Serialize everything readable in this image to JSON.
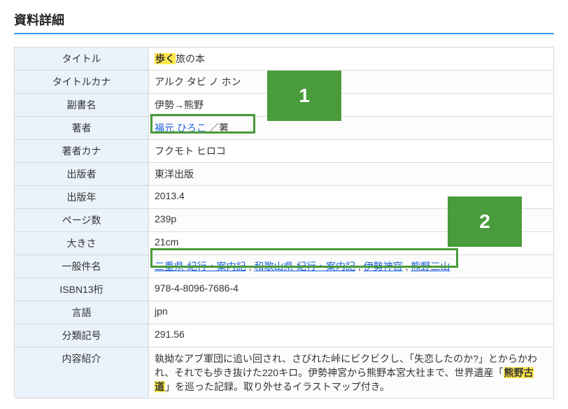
{
  "section_title": "資料詳細",
  "labels": {
    "title": "タイトル",
    "title_kana": "タイトルカナ",
    "subtitle": "副書名",
    "author": "著者",
    "author_kana": "著者カナ",
    "publisher": "出版者",
    "pub_year": "出版年",
    "pages": "ページ数",
    "size": "大きさ",
    "subjects": "一般件名",
    "isbn13": "ISBN13桁",
    "language": "言語",
    "class_no": "分類記号",
    "description": "内容紹介"
  },
  "values": {
    "title_highlight": "歩く",
    "title_rest": "旅の本",
    "title_kana": "アルク タビ ノ ホン",
    "subtitle": "伊勢→熊野",
    "author_link": "福元 ひろこ",
    "author_suffix": " ／著",
    "author_kana": "フクモト ヒロコ",
    "publisher": "東洋出版",
    "pub_year": "2013.4",
    "pages": "239p",
    "size": "21cm",
    "subject_sep": " , ",
    "subject1": "三重県-紀行・案内記",
    "subject2": "和歌山県-紀行・案内記",
    "subject3": "伊勢神宮",
    "subject4": "熊野三山",
    "isbn13": "978-4-8096-7686-4",
    "language": "jpn",
    "class_no": "291.56",
    "desc_pre": "執拗なアブ軍団に追い回され、さびれた峠にビクビクし、「失恋したのか?」とからかわれ、それでも歩き抜けた220キロ。伊勢神宮から熊野本宮大社まで、世界遺産「",
    "desc_hl": "熊野古道",
    "desc_post": "」を巡った記録。取り外せるイラストマップ付き。"
  },
  "callouts": {
    "one": "1",
    "two": "2"
  }
}
